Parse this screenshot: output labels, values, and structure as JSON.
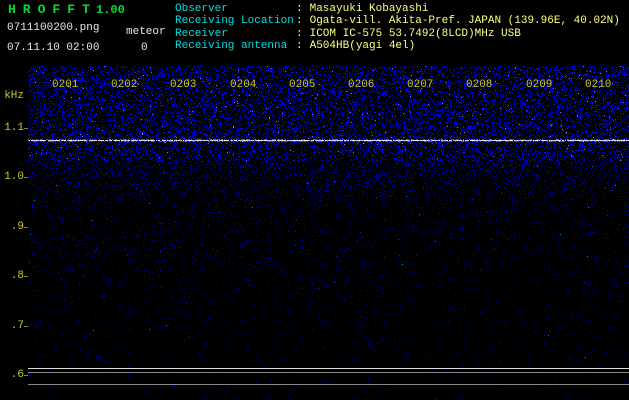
{
  "header": {
    "app_name": "HROFFT",
    "version": "1.00",
    "file_name": "0711100200.png",
    "meteor_label": "meteor",
    "meteor_count": "0",
    "datetime": "07.11.10 02:00",
    "separator": ":",
    "info": [
      {
        "label": "Observer",
        "value": "Masayuki Kobayashi"
      },
      {
        "label": "Receiving Location",
        "value": "Ogata-vill. Akita-Pref. JAPAN (139.96E, 40.02N)"
      },
      {
        "label": "Receiver",
        "value": "ICOM IC-575 53.7492(8LCD)MHz USB"
      },
      {
        "label": "Receiving antenna",
        "value": "A504HB(yagi 4el)"
      }
    ]
  },
  "spectrogram": {
    "y_unit": "kHz",
    "y_ticks": [
      "1.1",
      "1.0",
      ".9",
      ".8",
      ".7",
      ".6"
    ],
    "x_ticks": [
      "0201",
      "0202",
      "0203",
      "0204",
      "0205",
      "0206",
      "0207",
      "0208",
      "0209",
      "0210"
    ],
    "colors": {
      "noise_blue": "#0000cc",
      "carrier_line": "#cfe0ff",
      "axis_label": "#c9c92a",
      "label_cyan": "#00dfdf",
      "value_yellow": "#ffff80",
      "title_green": "#00dd33"
    }
  },
  "chart_data": {
    "type": "heatmap",
    "title": "HROFFT radio meteor echo spectrogram 0711100200",
    "x": [
      "0201",
      "0202",
      "0203",
      "0204",
      "0205",
      "0206",
      "0207",
      "0208",
      "0209",
      "0210"
    ],
    "ylabel": "kHz",
    "y_tick_values": [
      1.1,
      1.0,
      0.9,
      0.8,
      0.7,
      0.6
    ],
    "ylim": [
      0.55,
      1.18
    ],
    "legend": "none",
    "grid": "off",
    "features": [
      {
        "name": "carrier-line",
        "y_khz": 1.08,
        "extent": "full width",
        "appearance": "bright white-blue dashed horizontal line"
      },
      {
        "name": "upper-noise-band",
        "y_khz_range": [
          1.04,
          1.18
        ],
        "appearance": "dense blue noise speckle"
      },
      {
        "name": "background-noise",
        "appearance": "sparse dark-blue speckle fading toward low frequencies"
      },
      {
        "name": "signal-level-strip",
        "appearance": "flat level trace with gray grid lines at bottom of plot"
      }
    ],
    "meteor_echo_count": 0
  }
}
